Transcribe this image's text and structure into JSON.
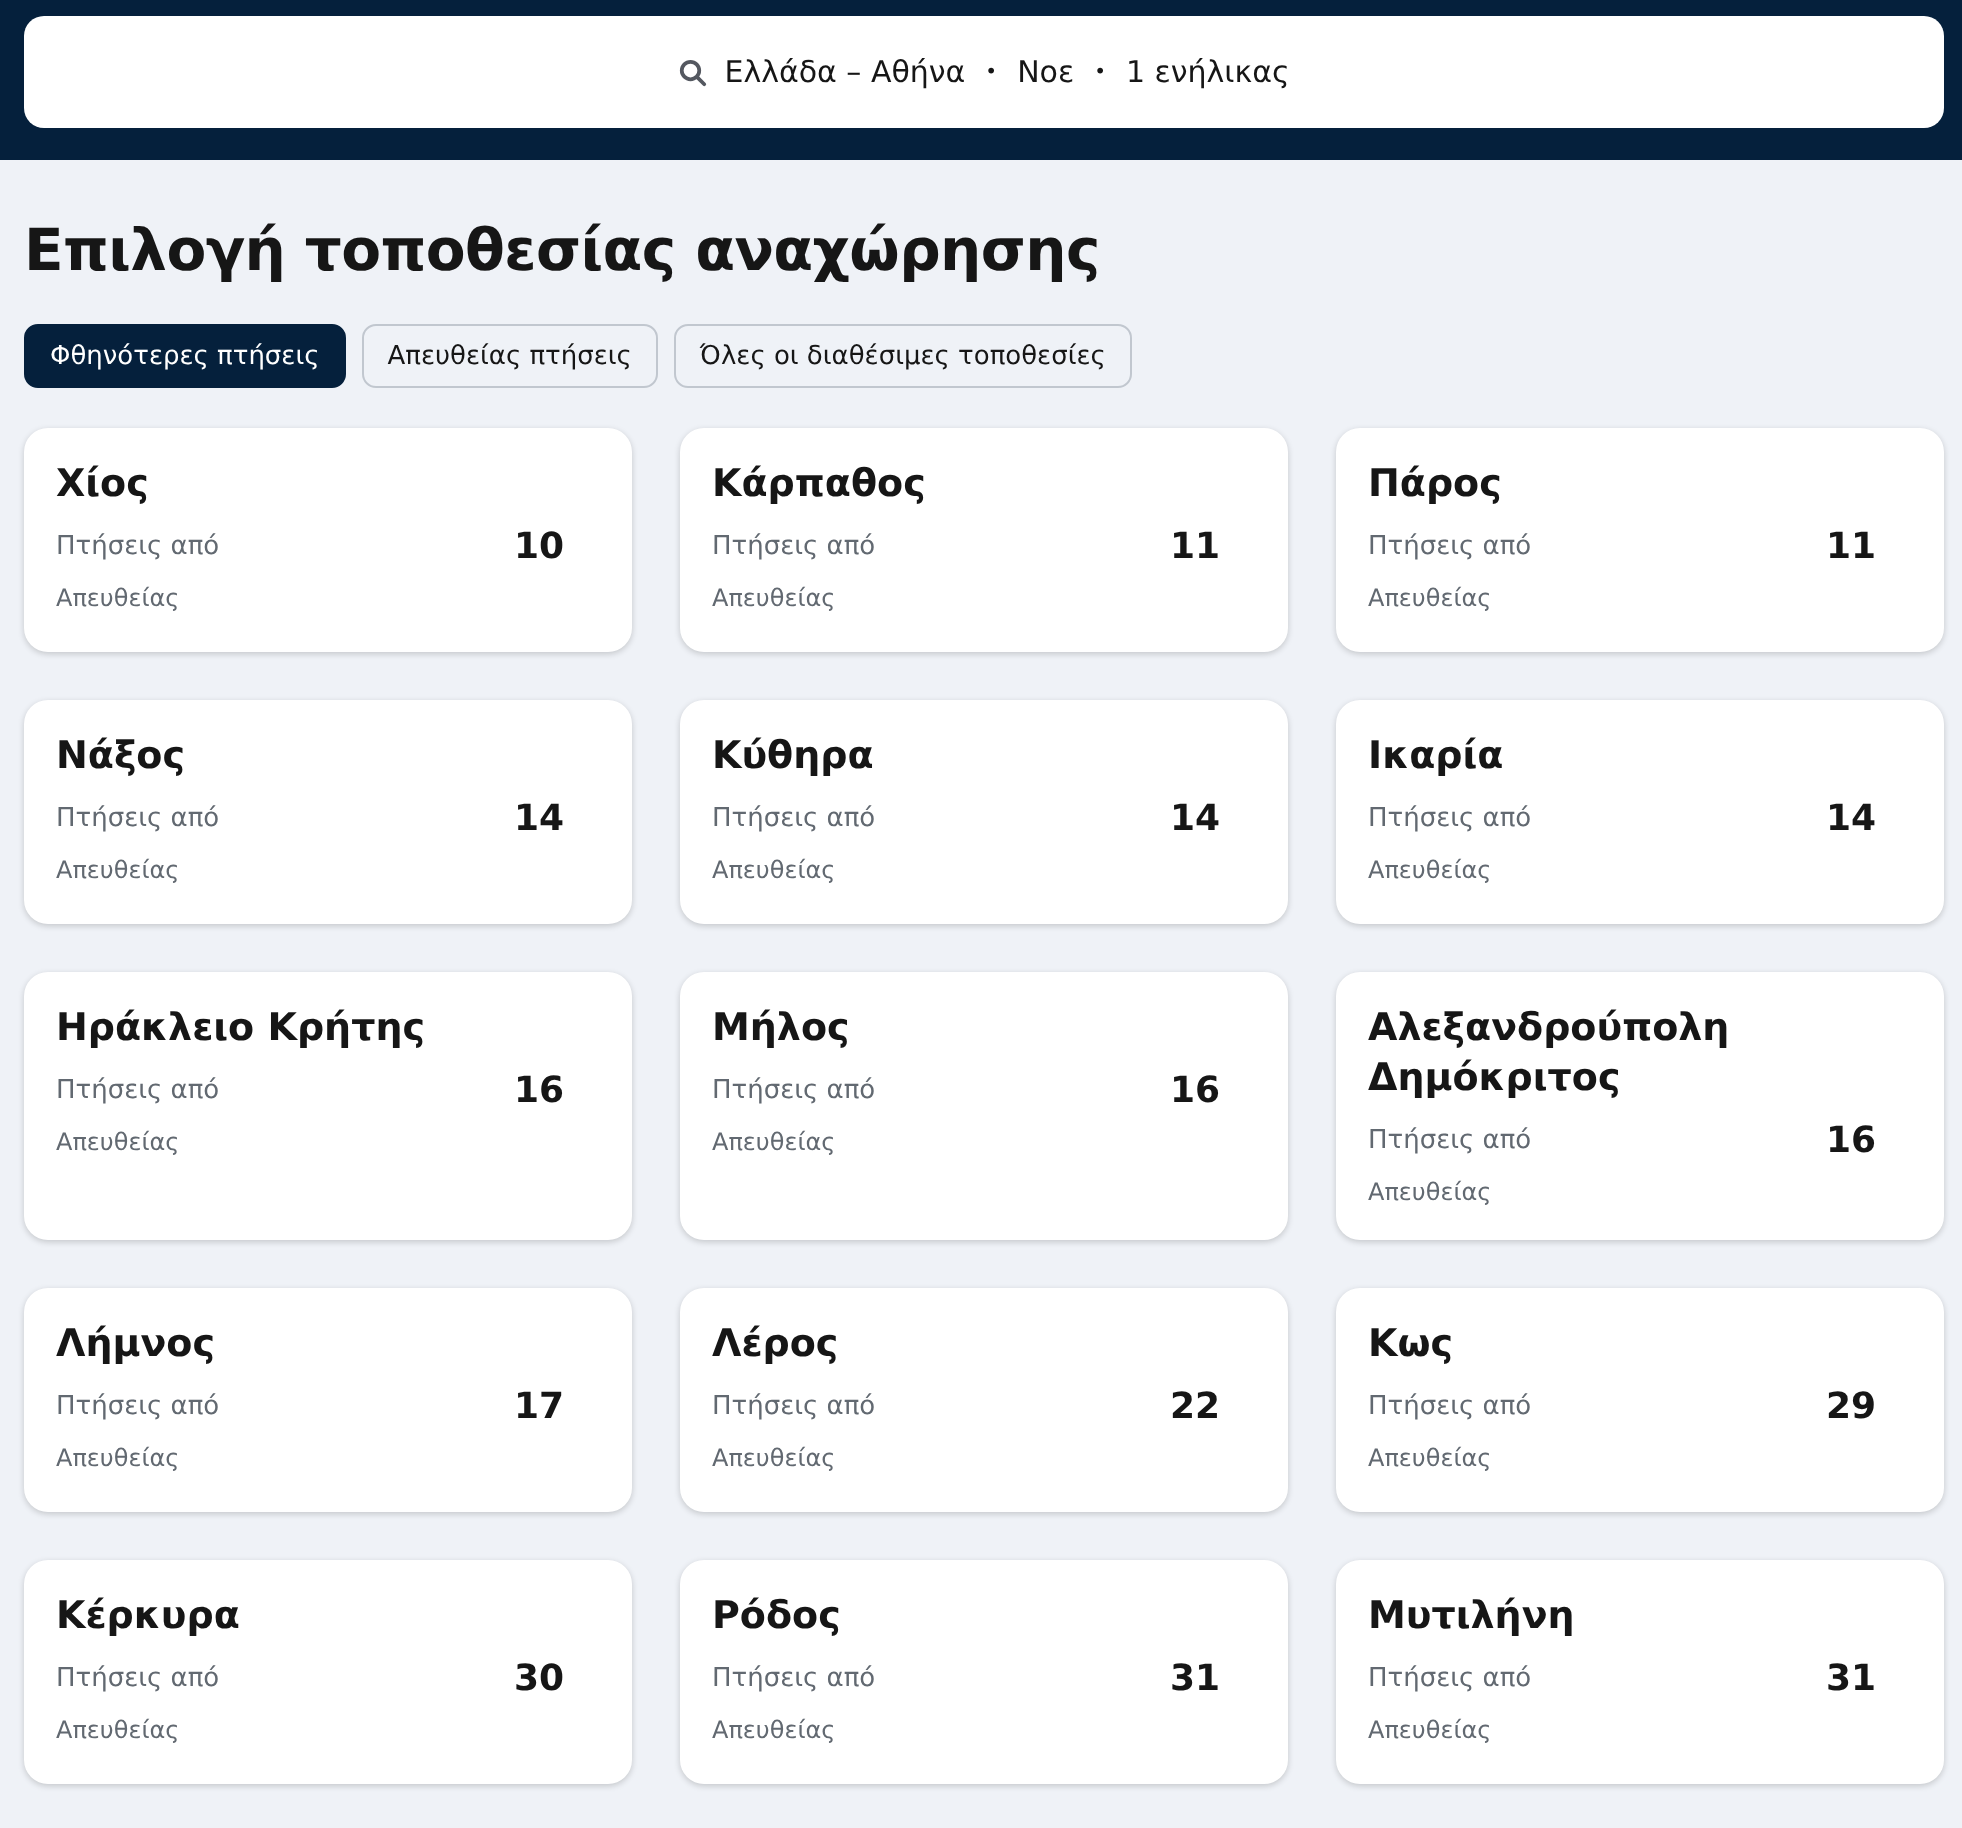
{
  "search": {
    "destination": "Ελλάδα – Αθήνα",
    "month": "Νοε",
    "travellers": "1 ενήλικας",
    "separator": "•"
  },
  "title": "Επιλογή τοποθεσίας αναχώρησης",
  "tabs": [
    {
      "label": "Φθηνότερες πτήσεις",
      "selected": true
    },
    {
      "label": "Απευθείας πτήσεις",
      "selected": false
    },
    {
      "label": "Όλες οι διαθέσιμες τοποθεσίες",
      "selected": false
    }
  ],
  "destinations": [
    {
      "name": "Χίος",
      "label": "Πτήσεις από",
      "price": "10",
      "note": "Απευθείας"
    },
    {
      "name": "Κάρπαθος",
      "label": "Πτήσεις από",
      "price": "11",
      "note": "Απευθείας"
    },
    {
      "name": "Πάρος",
      "label": "Πτήσεις από",
      "price": "11",
      "note": "Απευθείας"
    },
    {
      "name": "Νάξος",
      "label": "Πτήσεις από",
      "price": "14",
      "note": "Απευθείας"
    },
    {
      "name": "Κύθηρα",
      "label": "Πτήσεις από",
      "price": "14",
      "note": "Απευθείας"
    },
    {
      "name": "Ικαρία",
      "label": "Πτήσεις από",
      "price": "14",
      "note": "Απευθείας"
    },
    {
      "name": "Ηράκλειο Κρήτης",
      "label": "Πτήσεις από",
      "price": "16",
      "note": "Απευθείας"
    },
    {
      "name": "Μήλος",
      "label": "Πτήσεις από",
      "price": "16",
      "note": "Απευθείας"
    },
    {
      "name": "Αλεξανδρούπολη Δημόκριτος",
      "label": "Πτήσεις από",
      "price": "16",
      "note": "Απευθείας"
    },
    {
      "name": "Λήμνος",
      "label": "Πτήσεις από",
      "price": "17",
      "note": "Απευθείας"
    },
    {
      "name": "Λέρος",
      "label": "Πτήσεις από",
      "price": "22",
      "note": "Απευθείας"
    },
    {
      "name": "Κως",
      "label": "Πτήσεις από",
      "price": "29",
      "note": "Απευθείας"
    },
    {
      "name": "Κέρκυρα",
      "label": "Πτήσεις από",
      "price": "30",
      "note": "Απευθείας"
    },
    {
      "name": "Ρόδος",
      "label": "Πτήσεις από",
      "price": "31",
      "note": "Απευθείας"
    },
    {
      "name": "Μυτιλήνη",
      "label": "Πτήσεις από",
      "price": "31",
      "note": "Απευθείας"
    }
  ]
}
